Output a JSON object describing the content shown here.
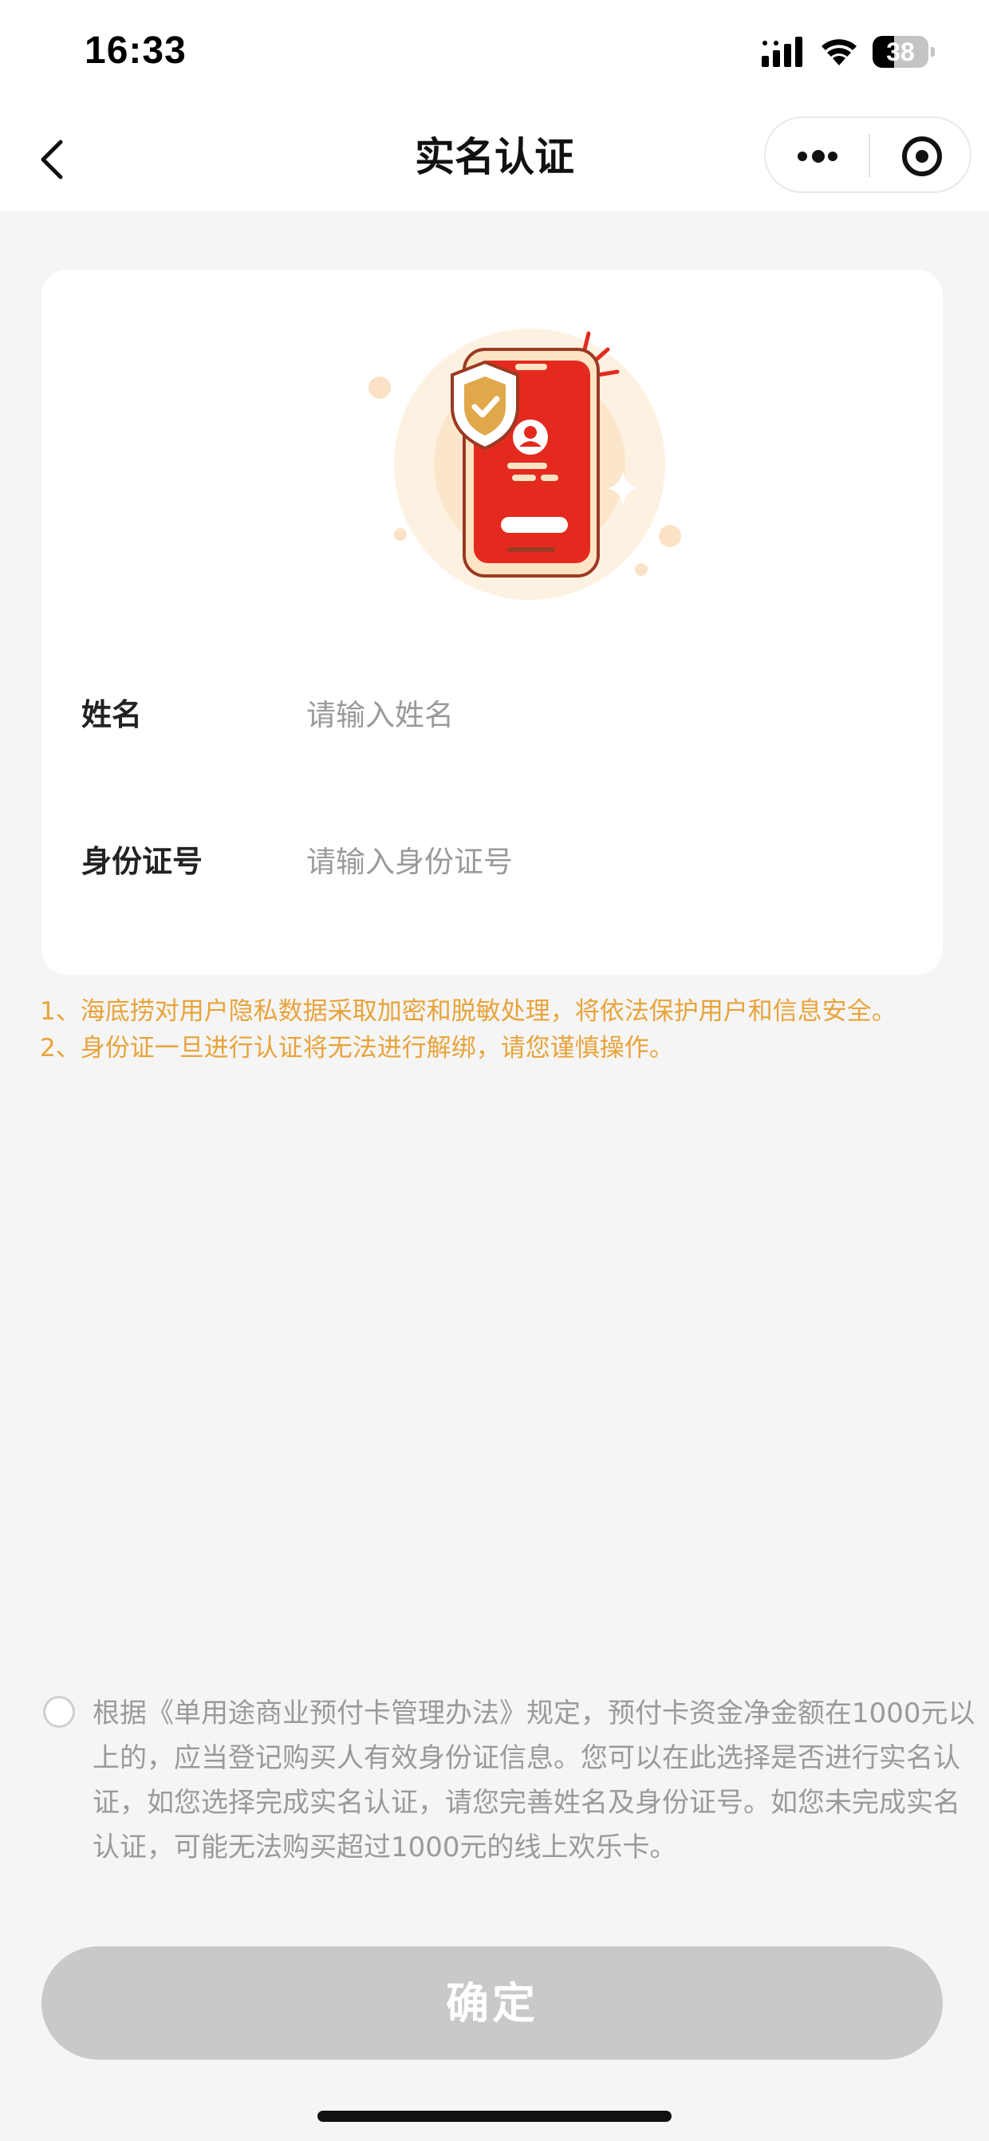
{
  "status_bar": {
    "time": "16:33",
    "battery_level": "38",
    "battery_fraction": 0.38
  },
  "nav": {
    "title": "实名认证"
  },
  "form": {
    "name_label": "姓名",
    "name_placeholder": "请输入姓名",
    "name_value": "",
    "id_label": "身份证号",
    "id_placeholder": "请输入身份证号",
    "id_value": ""
  },
  "notice": {
    "line1": "1、海底捞对用户隐私数据采取加密和脱敏处理，将依法保护用户和信息安全。",
    "line2": "2、身份证一旦进行认证将无法进行解绑，请您谨慎操作。"
  },
  "agreement": {
    "checked": false,
    "text": "根据《单用途商业预付卡管理办法》规定，预付卡资金净金额在1000元以上的，应当登记购买人有效身份证信息。您可以在此选择是否进行实名认证，如您选择完成实名认证，请您完善姓名及身份证号。如您未完成实名认证，可能无法购买超过1000元的线上欢乐卡。"
  },
  "confirm_button": {
    "label": "确定"
  },
  "colors": {
    "notice_text": "#e8a33a",
    "phone_red": "#e42a1e",
    "shield_gold": "#e0a84a",
    "button_disabled": "#c9c9c9"
  }
}
